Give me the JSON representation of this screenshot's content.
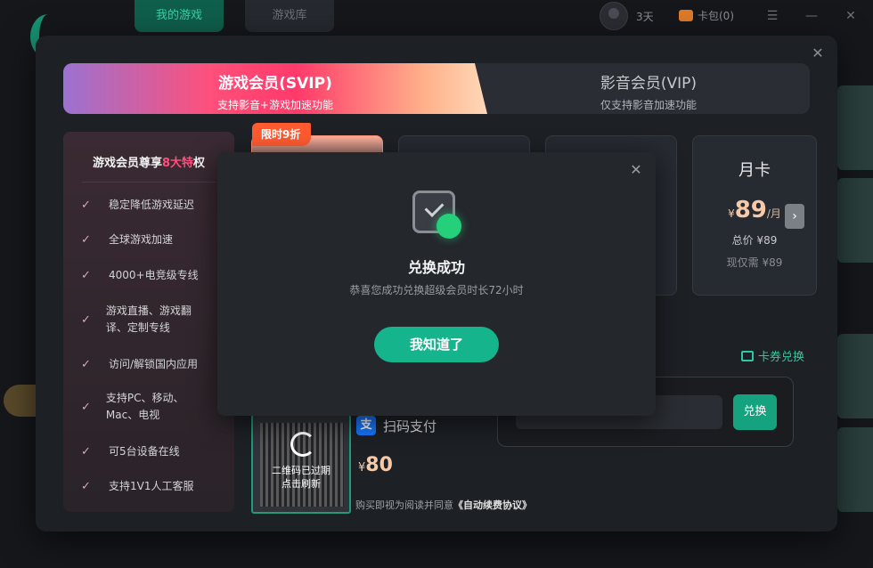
{
  "app": {
    "tabs": [
      "我的游戏",
      "游戏库"
    ],
    "days": "3天",
    "wallet": "卡包(0)"
  },
  "tabs": {
    "svip": {
      "title": "游戏会员(SVIP)",
      "sub": "支持影音+游戏加速功能"
    },
    "vip": {
      "title": "影音会员(VIP)",
      "sub": "仅支持影音加速功能"
    }
  },
  "perks": {
    "title_prefix": "游戏会员尊享",
    "title_highlight": "8大特",
    "title_suffix": "权",
    "items": [
      "稳定降低游戏延迟",
      "全球游戏加速",
      "4000+电竞级专线",
      "游戏直播、游戏翻译、定制专线",
      "访问/解锁国内应用",
      "支持PC、移动、Mac、电视",
      "可5台设备在线",
      "支持1V1人工客服"
    ]
  },
  "badge": "限时9折",
  "plan_month": {
    "title": "月卡",
    "currency": "¥",
    "price": "89",
    "unit": "/月",
    "total": "总价 ¥89",
    "now": "现仅需 ¥89"
  },
  "coupon_link": "卡券兑换",
  "redeem": {
    "button": "兑换"
  },
  "qr": {
    "line1": "二维码已过期",
    "line2": "点击刷新"
  },
  "pay": {
    "method": "扫码支付",
    "currency": "¥",
    "price": "80",
    "agree_prefix": "购买即视为阅读并同意",
    "agree_link": "《自动续费协议》"
  },
  "dialog": {
    "title": "兑换成功",
    "message": "恭喜您成功兑换超级会员时长72小时",
    "button": "我知道了"
  },
  "colors": {
    "accent": "#16b48c",
    "svip_pink": "#ff3a6a",
    "badge": "#ff5a30"
  }
}
